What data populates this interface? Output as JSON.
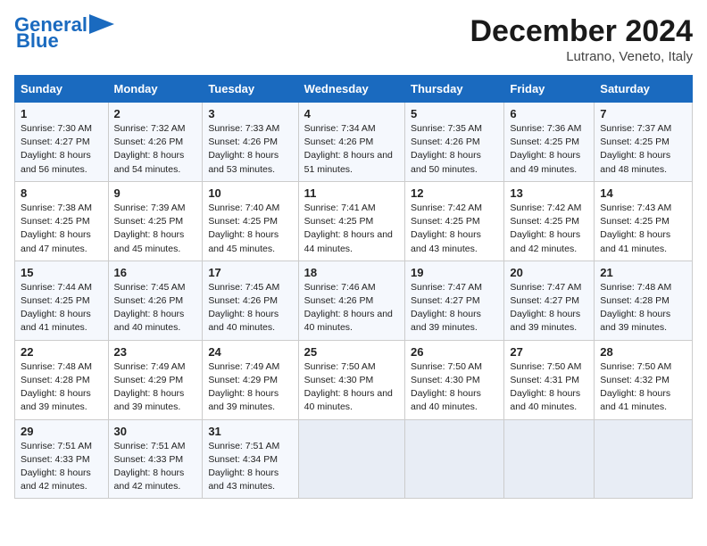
{
  "header": {
    "logo_line1": "General",
    "logo_line2": "Blue",
    "main_title": "December 2024",
    "subtitle": "Lutrano, Veneto, Italy"
  },
  "columns": [
    "Sunday",
    "Monday",
    "Tuesday",
    "Wednesday",
    "Thursday",
    "Friday",
    "Saturday"
  ],
  "weeks": [
    [
      {
        "day": "1",
        "sunrise": "Sunrise: 7:30 AM",
        "sunset": "Sunset: 4:27 PM",
        "daylight": "Daylight: 8 hours and 56 minutes."
      },
      {
        "day": "2",
        "sunrise": "Sunrise: 7:32 AM",
        "sunset": "Sunset: 4:26 PM",
        "daylight": "Daylight: 8 hours and 54 minutes."
      },
      {
        "day": "3",
        "sunrise": "Sunrise: 7:33 AM",
        "sunset": "Sunset: 4:26 PM",
        "daylight": "Daylight: 8 hours and 53 minutes."
      },
      {
        "day": "4",
        "sunrise": "Sunrise: 7:34 AM",
        "sunset": "Sunset: 4:26 PM",
        "daylight": "Daylight: 8 hours and 51 minutes."
      },
      {
        "day": "5",
        "sunrise": "Sunrise: 7:35 AM",
        "sunset": "Sunset: 4:26 PM",
        "daylight": "Daylight: 8 hours and 50 minutes."
      },
      {
        "day": "6",
        "sunrise": "Sunrise: 7:36 AM",
        "sunset": "Sunset: 4:25 PM",
        "daylight": "Daylight: 8 hours and 49 minutes."
      },
      {
        "day": "7",
        "sunrise": "Sunrise: 7:37 AM",
        "sunset": "Sunset: 4:25 PM",
        "daylight": "Daylight: 8 hours and 48 minutes."
      }
    ],
    [
      {
        "day": "8",
        "sunrise": "Sunrise: 7:38 AM",
        "sunset": "Sunset: 4:25 PM",
        "daylight": "Daylight: 8 hours and 47 minutes."
      },
      {
        "day": "9",
        "sunrise": "Sunrise: 7:39 AM",
        "sunset": "Sunset: 4:25 PM",
        "daylight": "Daylight: 8 hours and 45 minutes."
      },
      {
        "day": "10",
        "sunrise": "Sunrise: 7:40 AM",
        "sunset": "Sunset: 4:25 PM",
        "daylight": "Daylight: 8 hours and 45 minutes."
      },
      {
        "day": "11",
        "sunrise": "Sunrise: 7:41 AM",
        "sunset": "Sunset: 4:25 PM",
        "daylight": "Daylight: 8 hours and 44 minutes."
      },
      {
        "day": "12",
        "sunrise": "Sunrise: 7:42 AM",
        "sunset": "Sunset: 4:25 PM",
        "daylight": "Daylight: 8 hours and 43 minutes."
      },
      {
        "day": "13",
        "sunrise": "Sunrise: 7:42 AM",
        "sunset": "Sunset: 4:25 PM",
        "daylight": "Daylight: 8 hours and 42 minutes."
      },
      {
        "day": "14",
        "sunrise": "Sunrise: 7:43 AM",
        "sunset": "Sunset: 4:25 PM",
        "daylight": "Daylight: 8 hours and 41 minutes."
      }
    ],
    [
      {
        "day": "15",
        "sunrise": "Sunrise: 7:44 AM",
        "sunset": "Sunset: 4:25 PM",
        "daylight": "Daylight: 8 hours and 41 minutes."
      },
      {
        "day": "16",
        "sunrise": "Sunrise: 7:45 AM",
        "sunset": "Sunset: 4:26 PM",
        "daylight": "Daylight: 8 hours and 40 minutes."
      },
      {
        "day": "17",
        "sunrise": "Sunrise: 7:45 AM",
        "sunset": "Sunset: 4:26 PM",
        "daylight": "Daylight: 8 hours and 40 minutes."
      },
      {
        "day": "18",
        "sunrise": "Sunrise: 7:46 AM",
        "sunset": "Sunset: 4:26 PM",
        "daylight": "Daylight: 8 hours and 40 minutes."
      },
      {
        "day": "19",
        "sunrise": "Sunrise: 7:47 AM",
        "sunset": "Sunset: 4:27 PM",
        "daylight": "Daylight: 8 hours and 39 minutes."
      },
      {
        "day": "20",
        "sunrise": "Sunrise: 7:47 AM",
        "sunset": "Sunset: 4:27 PM",
        "daylight": "Daylight: 8 hours and 39 minutes."
      },
      {
        "day": "21",
        "sunrise": "Sunrise: 7:48 AM",
        "sunset": "Sunset: 4:28 PM",
        "daylight": "Daylight: 8 hours and 39 minutes."
      }
    ],
    [
      {
        "day": "22",
        "sunrise": "Sunrise: 7:48 AM",
        "sunset": "Sunset: 4:28 PM",
        "daylight": "Daylight: 8 hours and 39 minutes."
      },
      {
        "day": "23",
        "sunrise": "Sunrise: 7:49 AM",
        "sunset": "Sunset: 4:29 PM",
        "daylight": "Daylight: 8 hours and 39 minutes."
      },
      {
        "day": "24",
        "sunrise": "Sunrise: 7:49 AM",
        "sunset": "Sunset: 4:29 PM",
        "daylight": "Daylight: 8 hours and 39 minutes."
      },
      {
        "day": "25",
        "sunrise": "Sunrise: 7:50 AM",
        "sunset": "Sunset: 4:30 PM",
        "daylight": "Daylight: 8 hours and 40 minutes."
      },
      {
        "day": "26",
        "sunrise": "Sunrise: 7:50 AM",
        "sunset": "Sunset: 4:30 PM",
        "daylight": "Daylight: 8 hours and 40 minutes."
      },
      {
        "day": "27",
        "sunrise": "Sunrise: 7:50 AM",
        "sunset": "Sunset: 4:31 PM",
        "daylight": "Daylight: 8 hours and 40 minutes."
      },
      {
        "day": "28",
        "sunrise": "Sunrise: 7:50 AM",
        "sunset": "Sunset: 4:32 PM",
        "daylight": "Daylight: 8 hours and 41 minutes."
      }
    ],
    [
      {
        "day": "29",
        "sunrise": "Sunrise: 7:51 AM",
        "sunset": "Sunset: 4:33 PM",
        "daylight": "Daylight: 8 hours and 42 minutes."
      },
      {
        "day": "30",
        "sunrise": "Sunrise: 7:51 AM",
        "sunset": "Sunset: 4:33 PM",
        "daylight": "Daylight: 8 hours and 42 minutes."
      },
      {
        "day": "31",
        "sunrise": "Sunrise: 7:51 AM",
        "sunset": "Sunset: 4:34 PM",
        "daylight": "Daylight: 8 hours and 43 minutes."
      },
      null,
      null,
      null,
      null
    ]
  ]
}
